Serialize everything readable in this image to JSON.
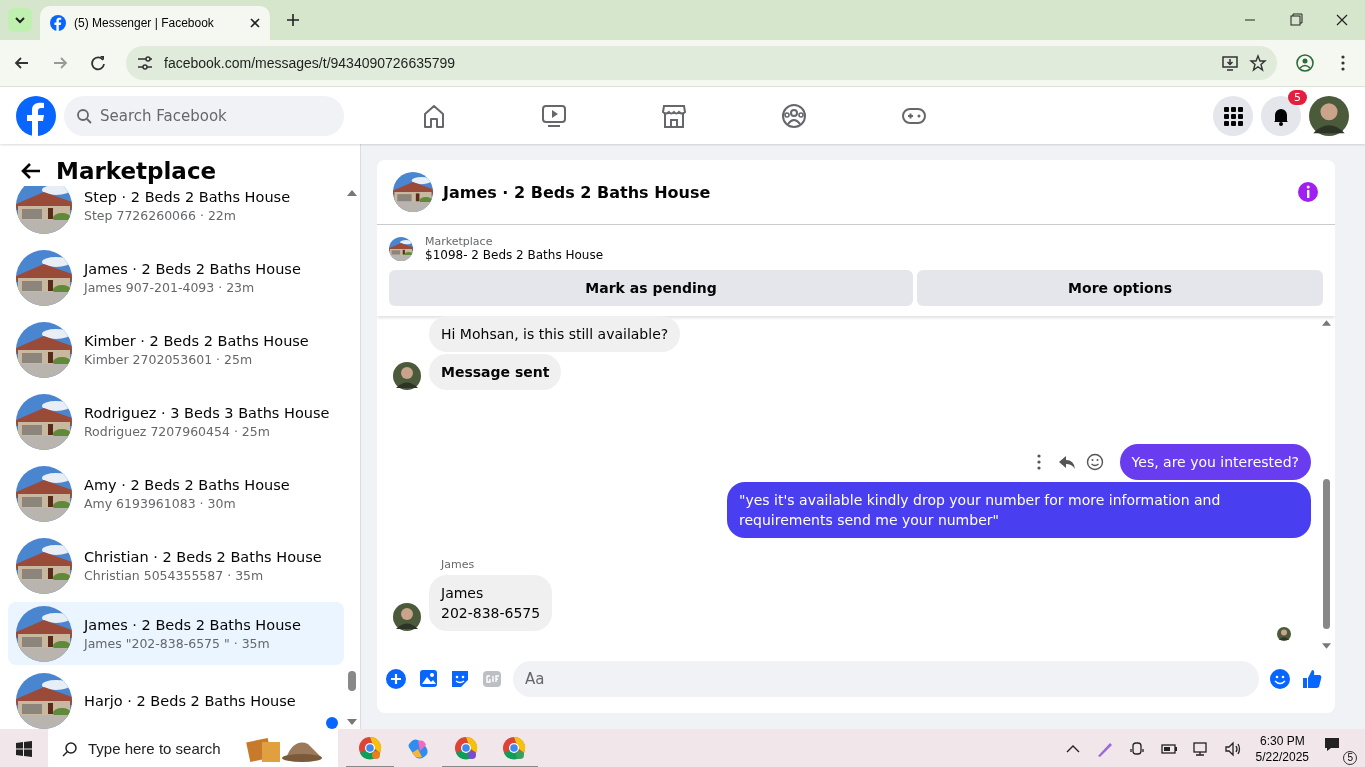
{
  "browser": {
    "tab_title": "(5) Messenger | Facebook",
    "url": "facebook.com/messages/t/9434090726635799"
  },
  "header": {
    "search_placeholder": "Search Facebook",
    "notification_count": "5"
  },
  "sidebar": {
    "title": "Marketplace",
    "conversations": [
      {
        "title": "Step · 2 Beds 2 Baths House",
        "subtitle": "Step 7726260066 · 22m",
        "selected": false,
        "unread": false
      },
      {
        "title": "James · 2 Beds 2 Baths House",
        "subtitle": "James 907-201-4093 · 23m",
        "selected": false,
        "unread": false
      },
      {
        "title": "Kimber · 2 Beds 2 Baths House",
        "subtitle": "Kimber 2702053601 · 25m",
        "selected": false,
        "unread": false
      },
      {
        "title": "Rodriguez · 3 Beds 3 Baths House",
        "subtitle": "Rodriguez 7207960454 · 25m",
        "selected": false,
        "unread": false
      },
      {
        "title": "Amy · 2 Beds 2 Baths House",
        "subtitle": "Amy 6193961083 · 30m",
        "selected": false,
        "unread": false
      },
      {
        "title": "Christian · 2 Beds 2 Baths House",
        "subtitle": "Christian 5054355587 · 35m",
        "selected": false,
        "unread": false
      },
      {
        "title": "James · 2 Beds 2 Baths House",
        "subtitle": "James \"202-838-6575 \" · 35m",
        "selected": true,
        "unread": false
      },
      {
        "title": "Harjo · 2 Beds 2 Baths House",
        "selected": false,
        "unread": true
      }
    ]
  },
  "chat": {
    "title": "James · 2 Beds 2 Baths House",
    "listing": {
      "label": "Marketplace",
      "title": "$1098- 2 Beds 2 Baths House"
    },
    "actions": [
      "Mark as pending",
      "More options"
    ],
    "messages": [
      {
        "kind": "incoming",
        "text": "Hi Mohsan, is this still available?",
        "avatar": false,
        "bold": false
      },
      {
        "kind": "incoming",
        "text": "Message sent",
        "avatar": true,
        "bold": true
      },
      {
        "kind": "outgoing",
        "text": "Yes, are you interested?",
        "tools": true,
        "color": "#6a3cf0"
      },
      {
        "kind": "outgoing",
        "text": "\"yes it's available kindly drop your number for more information and requirements send me your number\"",
        "tools": false,
        "color": "#4a3ff0"
      },
      {
        "kind": "incoming",
        "sender": "James",
        "text": "James\n202-838-6575",
        "avatar": true,
        "bold": false
      }
    ],
    "composer_placeholder": "Aa"
  },
  "taskbar": {
    "search_placeholder": "Type here to search",
    "time": "6:30 PM",
    "date": "5/22/2025",
    "notification_count": "5"
  }
}
